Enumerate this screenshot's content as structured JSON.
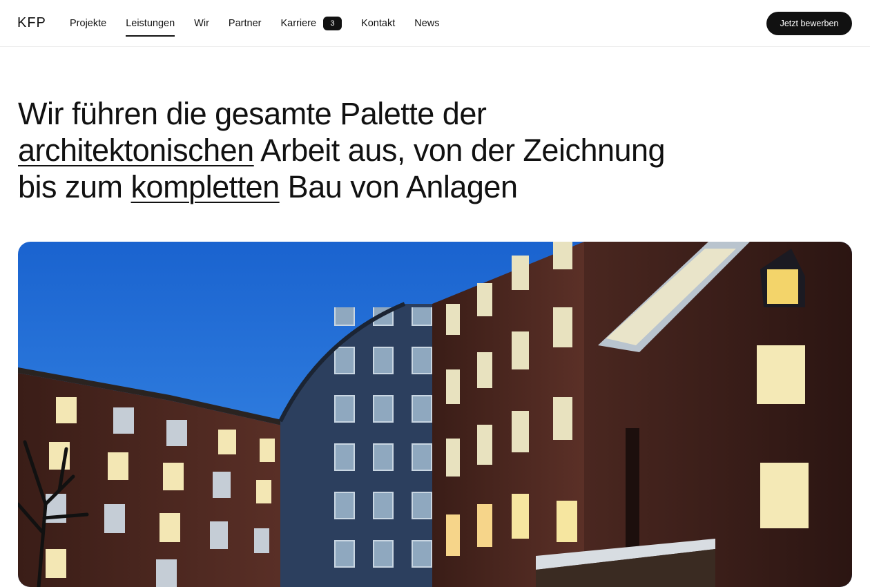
{
  "header": {
    "logo": "KFP",
    "nav": [
      {
        "label": "Projekte",
        "active": false
      },
      {
        "label": "Leistungen",
        "active": true
      },
      {
        "label": "Wir",
        "active": false
      },
      {
        "label": "Partner",
        "active": false
      },
      {
        "label": "Karriere",
        "active": false,
        "badge": "3"
      },
      {
        "label": "Kontakt",
        "active": false
      },
      {
        "label": "News",
        "active": false
      }
    ],
    "cta_label": "Jetzt bewerben"
  },
  "headline": {
    "part1": "Wir führen die gesamte Palette der ",
    "link1": "architektonischen",
    "part2": " Arbeit aus, von der Zeichnung bis zum ",
    "link2": "kompletten",
    "part3": " Bau von Anlagen"
  },
  "hero": {
    "image_icon": "building-photo",
    "sky_color": "#1e6fd6",
    "brick_color": "#5a2f25"
  },
  "colors": {
    "text": "#111111",
    "background": "#ffffff",
    "button_bg": "#111111"
  }
}
